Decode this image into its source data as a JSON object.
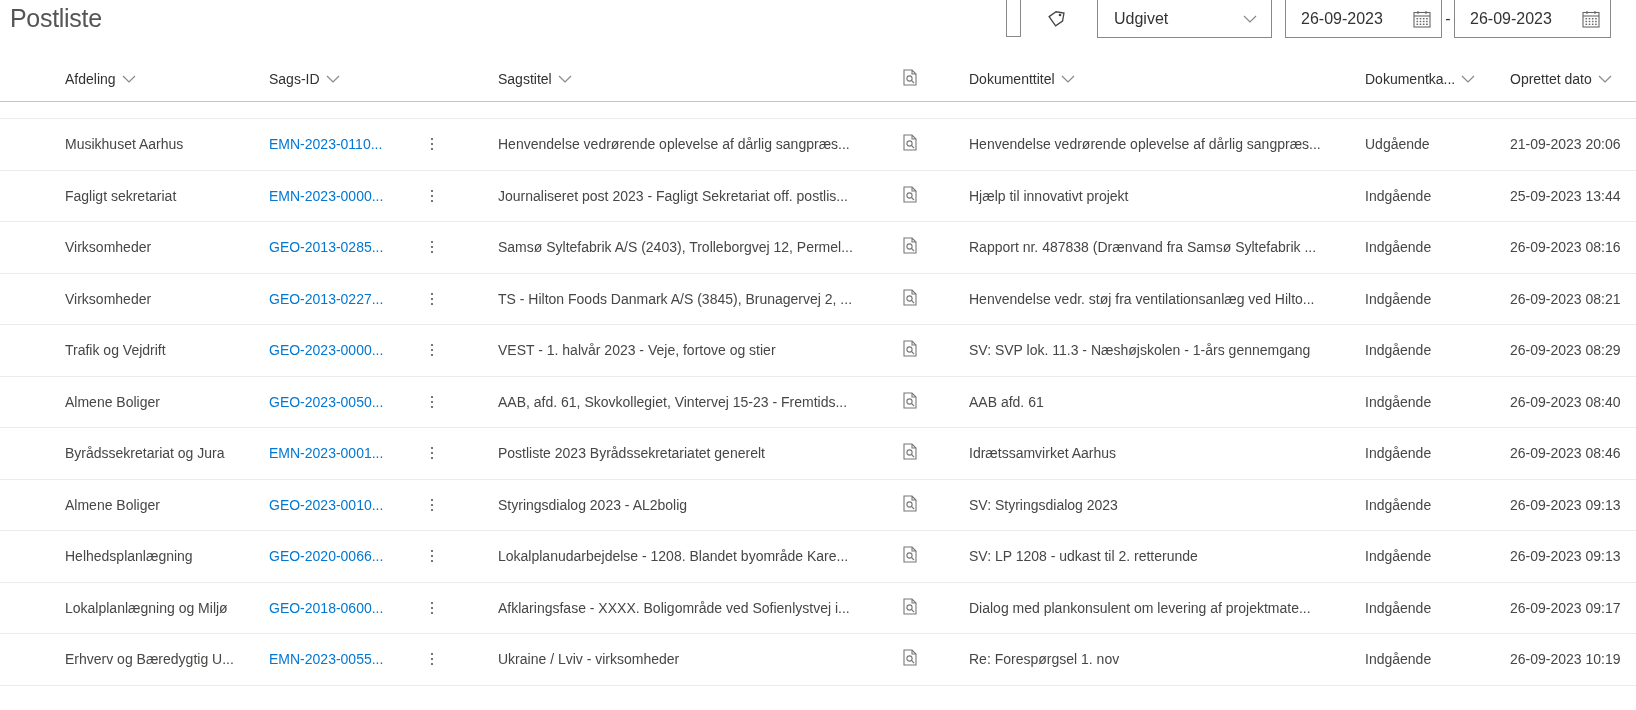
{
  "page": {
    "title": "Postliste"
  },
  "toolbar": {
    "status_dropdown": {
      "value": "Udgivet"
    },
    "date_from": {
      "value": "26-09-2023"
    },
    "date_separator": "-",
    "date_to": {
      "value": "26-09-2023"
    }
  },
  "table": {
    "columns": [
      {
        "kind": "text",
        "label": "Afdeling"
      },
      {
        "kind": "text",
        "label": "Sags-ID"
      },
      {
        "kind": "blank"
      },
      {
        "kind": "text",
        "label": "Sagstitel"
      },
      {
        "kind": "icon"
      },
      {
        "kind": "text",
        "label": "Dokumenttitel"
      },
      {
        "kind": "text",
        "label": "Dokumentka..."
      },
      {
        "kind": "text",
        "label": "Oprettet dato"
      }
    ],
    "rows": [
      {
        "department": "Musikhuset Aarhus",
        "case_id": "EMN-2023-0110...",
        "case_title": "Henvendelse vedrørende oplevelse af dårlig sangpræs...",
        "document_title": "Henvendelse vedrørende oplevelse af dårlig sangpræs...",
        "category": "Udgående",
        "created": "21-09-2023 20:06"
      },
      {
        "department": "Fagligt sekretariat",
        "case_id": "EMN-2023-0000...",
        "case_title": "Journaliseret post 2023 - Fagligt Sekretariat off. postlis...",
        "document_title": "Hjælp til innovativt projekt",
        "category": "Indgående",
        "created": "25-09-2023 13:44"
      },
      {
        "department": "Virksomheder",
        "case_id": "GEO-2013-0285...",
        "case_title": "Samsø Syltefabrik A/S (2403), Trolleborgvej 12, Permel...",
        "document_title": "Rapport nr. 487838 (Drænvand fra Samsø Syltefabrik ...",
        "category": "Indgående",
        "created": "26-09-2023 08:16"
      },
      {
        "department": "Virksomheder",
        "case_id": "GEO-2013-0227...",
        "case_title": "TS - Hilton Foods Danmark A/S (3845), Brunagervej 2, ...",
        "document_title": "Henvendelse vedr. støj fra ventilationsanlæg ved Hilto...",
        "category": "Indgående",
        "created": "26-09-2023 08:21"
      },
      {
        "department": "Trafik og Vejdrift",
        "case_id": "GEO-2023-0000...",
        "case_title": "VEST - 1. halvår 2023 - Veje, fortove og stier",
        "document_title": "SV: SVP lok. 11.3 - Næshøjskolen - 1-års gennemgang",
        "category": "Indgående",
        "created": "26-09-2023 08:29"
      },
      {
        "department": "Almene Boliger",
        "case_id": "GEO-2023-0050...",
        "case_title": "AAB, afd. 61, Skovkollegiet, Vintervej 15-23 - Fremtids...",
        "document_title": "AAB afd. 61",
        "category": "Indgående",
        "created": "26-09-2023 08:40"
      },
      {
        "department": "Byrådssekretariat og Jura",
        "case_id": "EMN-2023-0001...",
        "case_title": "Postliste 2023 Byrådssekretariatet generelt",
        "document_title": "Idrætssamvirket Aarhus",
        "category": "Indgående",
        "created": "26-09-2023 08:46"
      },
      {
        "department": "Almene Boliger",
        "case_id": "GEO-2023-0010...",
        "case_title": "Styringsdialog 2023 - AL2bolig",
        "document_title": "SV: Styringsdialog 2023",
        "category": "Indgående",
        "created": "26-09-2023 09:13"
      },
      {
        "department": "Helhedsplanlægning",
        "case_id": "GEO-2020-0066...",
        "case_title": "Lokalplanudarbejdelse - 1208. Blandet byområde Kare...",
        "document_title": "SV: LP 1208 - udkast til 2. retterunde",
        "category": "Indgående",
        "created": "26-09-2023 09:13"
      },
      {
        "department": "Lokalplanlægning og Miljø",
        "case_id": "GEO-2018-0600...",
        "case_title": "Afklaringsfase - XXXX. Boligområde ved Sofienlystvej i...",
        "document_title": "Dialog med plankonsulent om levering af projektmate...",
        "category": "Indgående",
        "created": "26-09-2023 09:17"
      },
      {
        "department": "Erhverv og Bæredygtig U...",
        "case_id": "EMN-2023-0055...",
        "case_title": "Ukraine / Lviv - virksomheder",
        "document_title": "Re: Forespørgsel 1. nov",
        "category": "Indgående",
        "created": "26-09-2023 10:19"
      }
    ]
  }
}
